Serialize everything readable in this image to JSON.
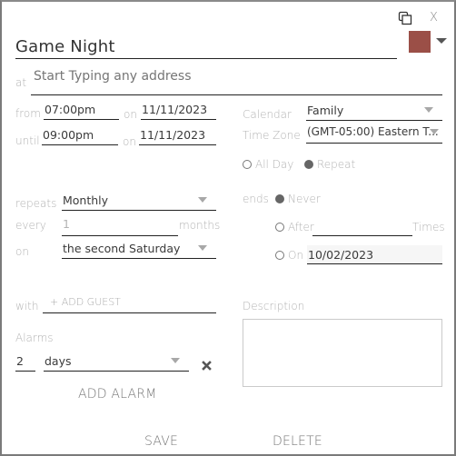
{
  "header": {
    "title": "Game Night",
    "color_swatch": "#9b4f47",
    "copy_icon": "copy-icon",
    "close_label": "X"
  },
  "location": {
    "label": "at",
    "placeholder": "Start Typing any address",
    "value": ""
  },
  "time": {
    "from_label": "from",
    "from_time": "07:00pm",
    "from_on_label": "on",
    "from_date": "11/11/2023",
    "until_label": "until",
    "until_time": "09:00pm",
    "until_on_label": "on",
    "until_date": "11/11/2023"
  },
  "calendar": {
    "label": "Calendar",
    "value": "Family",
    "timezone_label": "Time Zone",
    "timezone_value": "(GMT-05:00) Eastern T..."
  },
  "options": {
    "all_day_label": "All Day",
    "all_day_checked": false,
    "repeat_label": "Repeat",
    "repeat_checked": true
  },
  "repeat": {
    "repeats_label": "repeats",
    "repeats_value": "Monthly",
    "every_label": "every",
    "every_value": "1",
    "every_unit": "months",
    "on_label": "on",
    "on_value": "the second Saturday"
  },
  "ends": {
    "label": "ends",
    "never_label": "Never",
    "never_checked": true,
    "after_label": "After",
    "after_value": "",
    "after_unit": "Times",
    "after_checked": false,
    "on_label": "On",
    "on_value": "10/02/2023",
    "on_checked": false
  },
  "guests": {
    "label": "with",
    "add_guest_label": "+ ADD GUEST"
  },
  "description": {
    "label": "Description",
    "value": ""
  },
  "alarms": {
    "label": "Alarms",
    "items": [
      {
        "amount": "2",
        "unit": "days"
      }
    ],
    "add_label": "ADD ALARM"
  },
  "footer": {
    "save_label": "SAVE",
    "delete_label": "DELETE"
  }
}
